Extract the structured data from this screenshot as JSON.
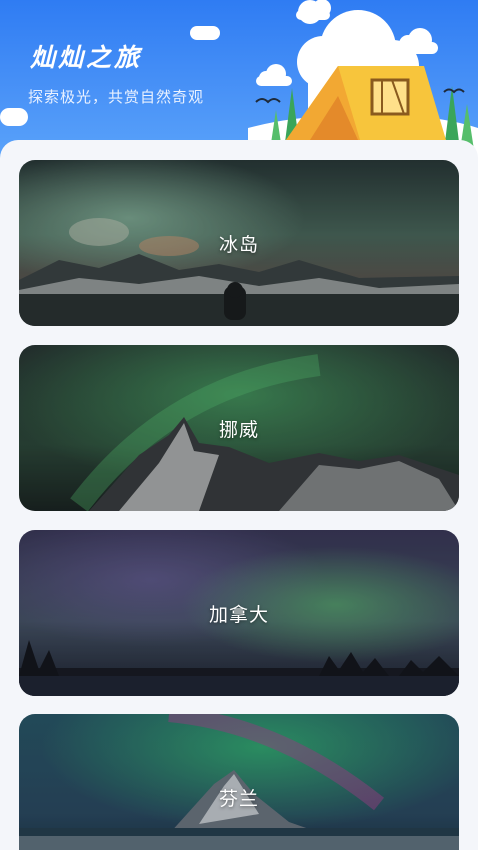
{
  "header": {
    "title": "灿灿之旅",
    "subtitle": "探索极光，共赏自然奇观"
  },
  "destinations": [
    {
      "name": "冰岛"
    },
    {
      "name": "挪威"
    },
    {
      "name": "加拿大"
    },
    {
      "name": "芬兰"
    }
  ],
  "colors": {
    "header_blue": "#2f7cf3",
    "aurora_green": "#3fbf6a",
    "tent_yellow": "#f7c53c"
  },
  "icons": [
    "tent-icon",
    "cloud-icon",
    "bird-icon",
    "tree-icon"
  ]
}
